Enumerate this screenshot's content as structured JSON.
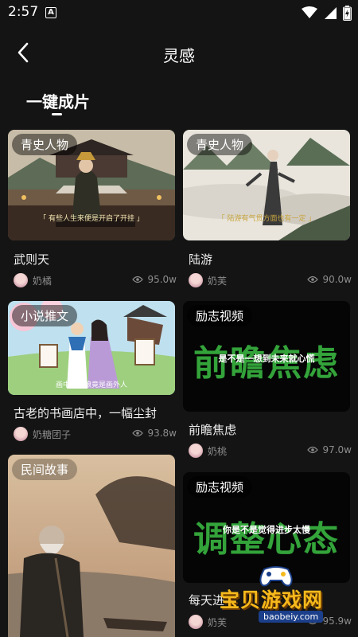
{
  "status_bar": {
    "time": "2:57",
    "notification_glyph": "A"
  },
  "header": {
    "title": "灵感"
  },
  "section": {
    "title": "一键成片"
  },
  "cards": [
    {
      "tag": "青史人物",
      "title": "武则天",
      "author": "奶橘",
      "views": "95.0w",
      "caption": "「 有些人生来便是开启了开挂 」"
    },
    {
      "tag": "青史人物",
      "title": "陆游",
      "author": "奶芙",
      "views": "90.0w",
      "caption": "「 陆游有气贯方面也有一定 」"
    },
    {
      "tag": "小说推文",
      "title": "古老的书画店中，一幅尘封",
      "author": "奶糖团子",
      "views": "93.8w",
      "caption": "画中的姑娘竟是画外人"
    },
    {
      "tag": "励志视频",
      "title": "前瞻焦虑",
      "author": "奶桃",
      "views": "97.0w",
      "overlay_big": "前瞻焦虑",
      "overlay_line": "是不是一想到未来就心慌"
    },
    {
      "tag": "民间故事",
      "title": "",
      "author": "",
      "views": ""
    },
    {
      "tag": "励志视频",
      "title": "每天进",
      "author": "奶芙",
      "views": "95.9w",
      "overlay_big": "调整心态",
      "overlay_line": "你是不是觉得进步太慢"
    }
  ],
  "watermark": {
    "text": "宝贝游戏网",
    "url": "baobeiy.com"
  },
  "colors": {
    "background": "#141414",
    "green_text": "#33a33a",
    "muted": "#8c8c8c",
    "watermark_gold": "#f6b91b"
  }
}
